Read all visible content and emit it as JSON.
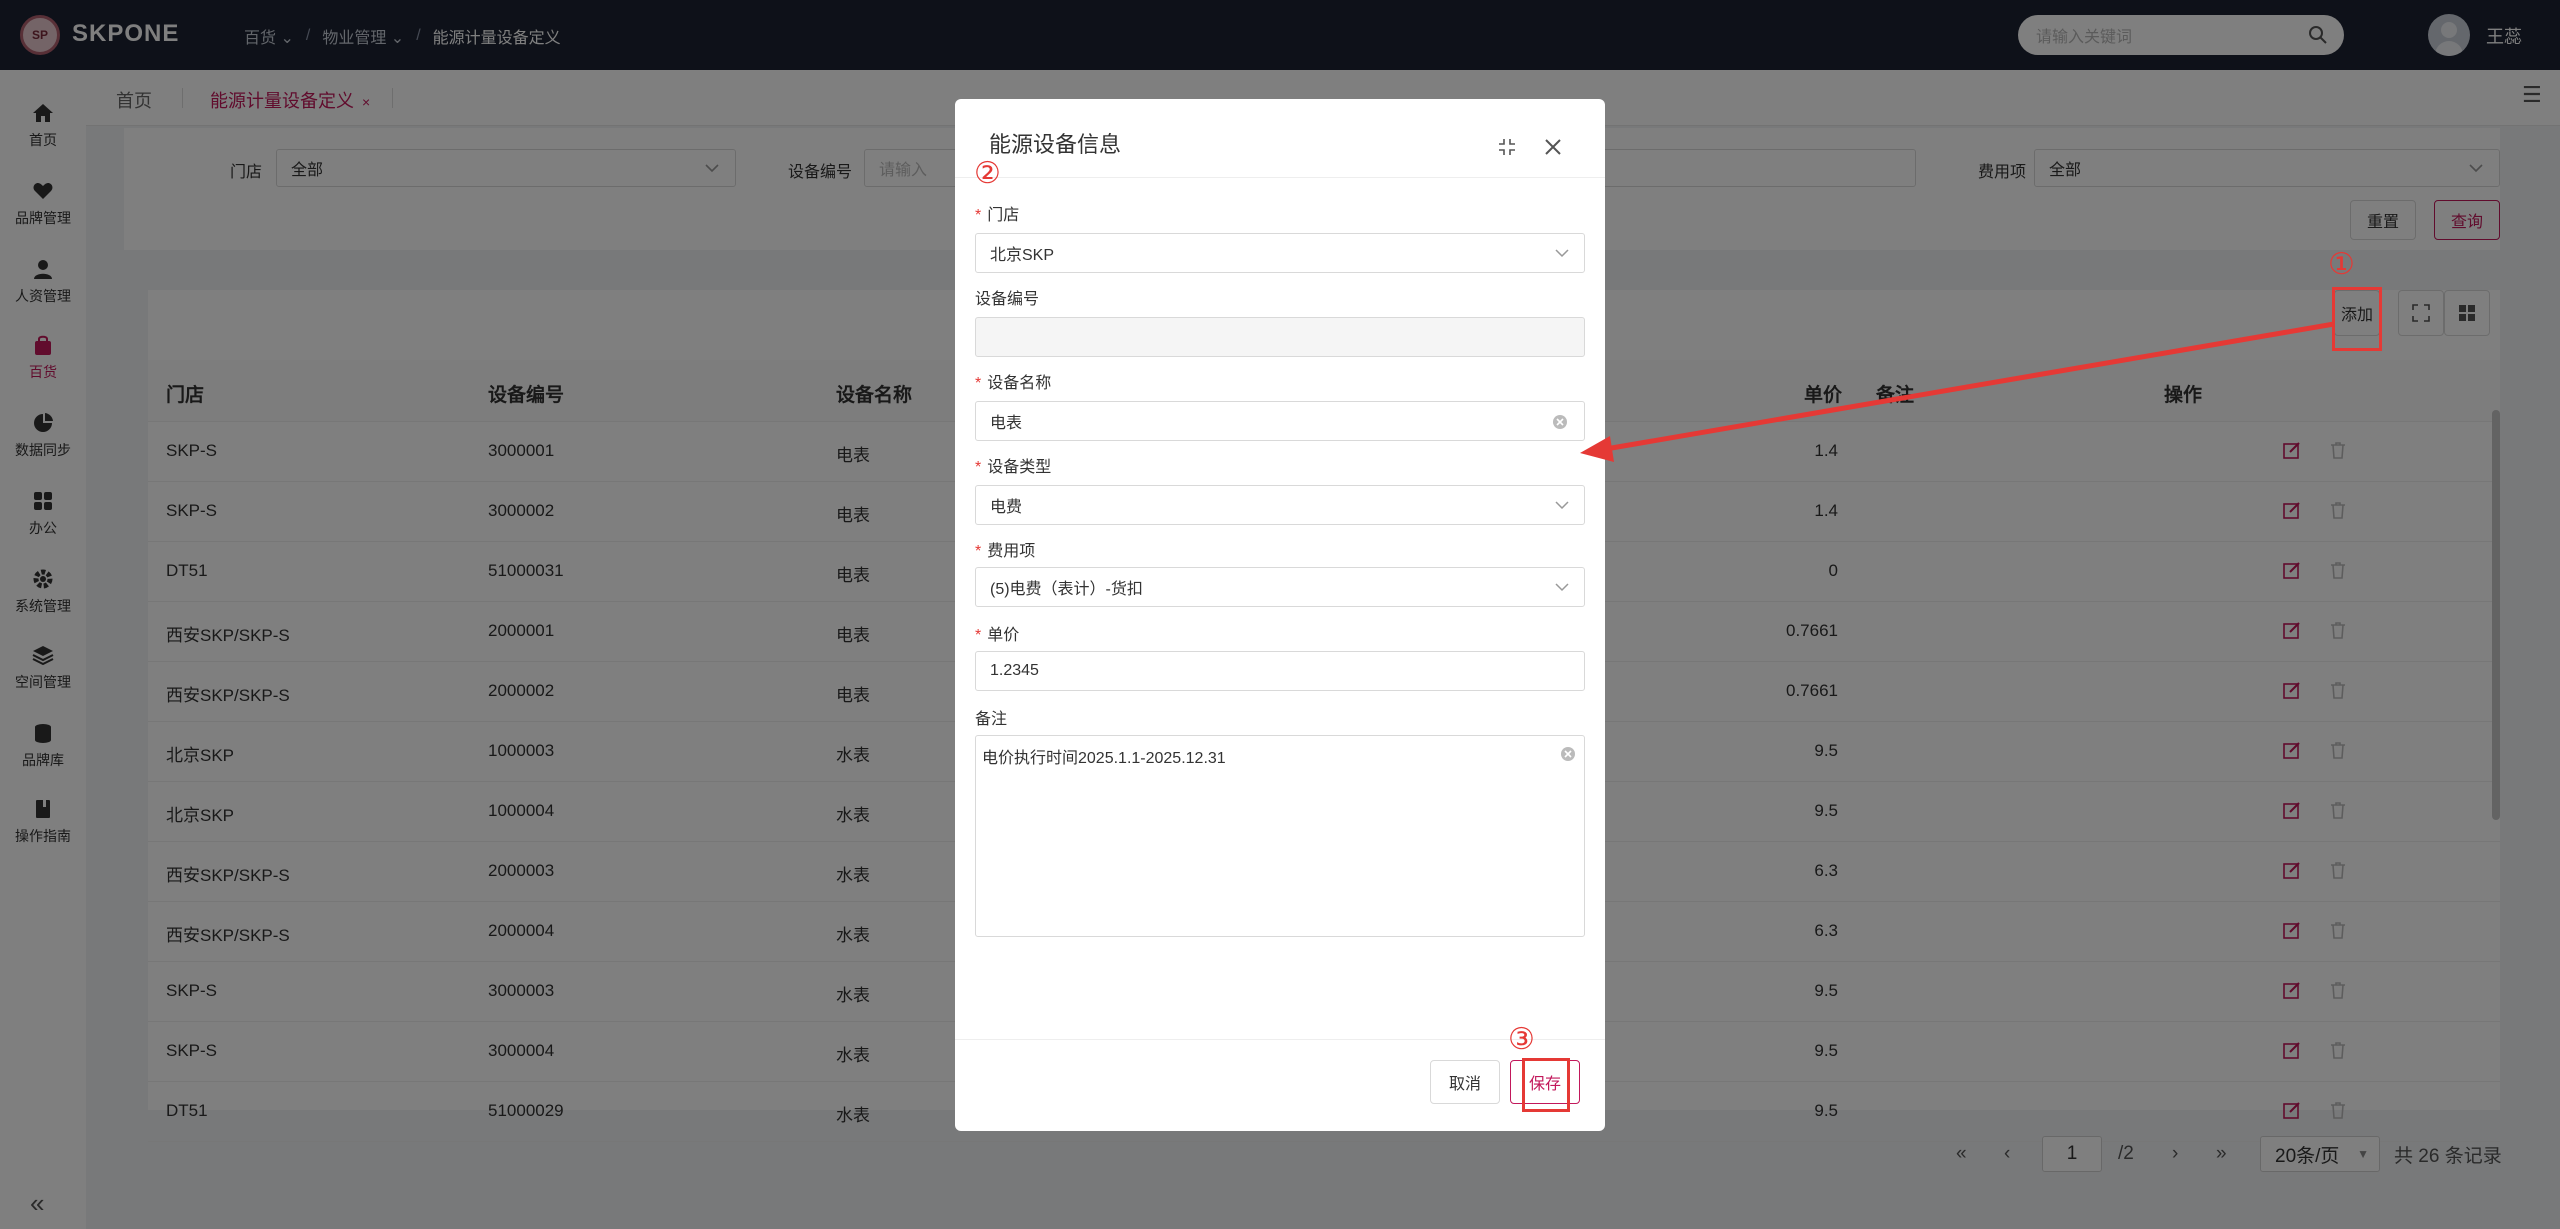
{
  "topbar": {
    "logo_mark": "SP",
    "logo_text": "SKPONE",
    "breadcrumbs": [
      "百货",
      "物业管理",
      "能源计量设备定义"
    ],
    "search_placeholder": "请输入关键词",
    "user_name": "王蕊"
  },
  "sidebar": {
    "items": [
      {
        "label": "首页",
        "icon": "home-icon"
      },
      {
        "label": "品牌管理",
        "icon": "heart-icon"
      },
      {
        "label": "人资管理",
        "icon": "person-icon"
      },
      {
        "label": "百货",
        "icon": "bag-icon",
        "active": true
      },
      {
        "label": "数据同步",
        "icon": "pie-icon"
      },
      {
        "label": "办公",
        "icon": "grid-icon"
      },
      {
        "label": "系统管理",
        "icon": "gear-icon"
      },
      {
        "label": "空间管理",
        "icon": "layers-icon"
      },
      {
        "label": "品牌库",
        "icon": "database-icon"
      },
      {
        "label": "操作指南",
        "icon": "book-icon"
      }
    ],
    "collapse_glyph": "«"
  },
  "tabs": {
    "home": "首页",
    "current": "能源计量设备定义",
    "close": "×"
  },
  "filter": {
    "store_label": "门店",
    "store_value": "全部",
    "device_no_label": "设备编号",
    "device_no_placeholder": "请输入",
    "fee_label": "费用项",
    "fee_value": "全部",
    "reset": "重置",
    "query": "查询"
  },
  "toolbar": {
    "add": "添加"
  },
  "table": {
    "columns": [
      "门店",
      "设备编号",
      "设备名称",
      "单价",
      "备注",
      "操作"
    ],
    "rows": [
      {
        "store": "SKP-S",
        "code": "3000001",
        "name": "电表",
        "price": "1.4"
      },
      {
        "store": "SKP-S",
        "code": "3000002",
        "name": "电表",
        "price": "1.4"
      },
      {
        "store": "DT51",
        "code": "51000031",
        "name": "电表",
        "price": "0"
      },
      {
        "store": "西安SKP/SKP-S",
        "code": "2000001",
        "name": "电表",
        "price": "0.7661"
      },
      {
        "store": "西安SKP/SKP-S",
        "code": "2000002",
        "name": "电表",
        "price": "0.7661"
      },
      {
        "store": "北京SKP",
        "code": "1000003",
        "name": "水表",
        "price": "9.5"
      },
      {
        "store": "北京SKP",
        "code": "1000004",
        "name": "水表",
        "price": "9.5"
      },
      {
        "store": "西安SKP/SKP-S",
        "code": "2000003",
        "name": "水表",
        "price": "6.3"
      },
      {
        "store": "西安SKP/SKP-S",
        "code": "2000004",
        "name": "水表",
        "price": "6.3"
      },
      {
        "store": "SKP-S",
        "code": "3000003",
        "name": "水表",
        "price": "9.5"
      },
      {
        "store": "SKP-S",
        "code": "3000004",
        "name": "水表",
        "price": "9.5"
      },
      {
        "store": "DT51",
        "code": "51000029",
        "name": "水表",
        "price": "9.5"
      }
    ]
  },
  "pagination": {
    "page": "1",
    "total_pages": "/2",
    "page_size": "20条/页",
    "total": "共 26 条记录"
  },
  "modal": {
    "title": "能源设备信息",
    "store_label": "门店",
    "store_value": "北京SKP",
    "device_no_label": "设备编号",
    "device_no_value": "",
    "device_name_label": "设备名称",
    "device_name_value": "电表",
    "device_type_label": "设备类型",
    "device_type_value": "电费",
    "fee_label": "费用项",
    "fee_value": "(5)电费（表计）-货扣",
    "price_label": "单价",
    "price_value": "1.2345",
    "remark_label": "备注",
    "remark_value": "电价执行时间2025.1.1-2025.12.31",
    "cancel": "取消",
    "save": "保存",
    "required_mark": "*"
  },
  "annotations": {
    "n1": "①",
    "n2": "②",
    "n3": "③",
    "color": "#e53935"
  },
  "colors": {
    "brand": "#c2185b",
    "topbar": "#1c2333"
  }
}
